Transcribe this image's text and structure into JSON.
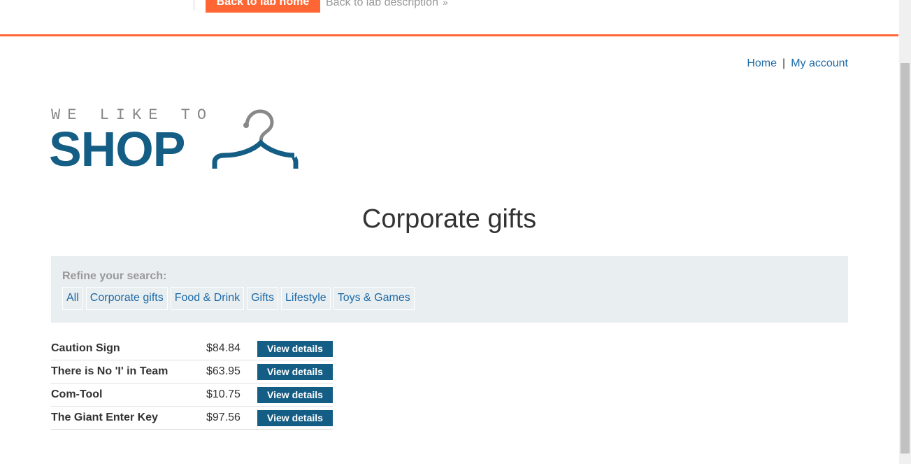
{
  "banner": {
    "back_home": "Back to lab home",
    "back_desc": "Back to lab description",
    "back_desc_chevron": "»",
    "accent": "#ff6633"
  },
  "nav": {
    "home": "Home",
    "separator": "|",
    "account": "My account"
  },
  "logo": {
    "tagline": "WE LIKE TO",
    "word": "SHOP",
    "icon": "hanger-icon",
    "brand_color": "#145d85"
  },
  "page": {
    "title": "Corporate gifts"
  },
  "filters": {
    "label": "Refine your search:",
    "categories": [
      "All",
      "Corporate gifts",
      "Food & Drink",
      "Gifts",
      "Lifestyle",
      "Toys & Games"
    ]
  },
  "products": [
    {
      "name": "Caution Sign",
      "price": "$84.84",
      "action": "View details"
    },
    {
      "name": "There is No 'I' in Team",
      "price": "$63.95",
      "action": "View details"
    },
    {
      "name": "Com-Tool",
      "price": "$10.75",
      "action": "View details"
    },
    {
      "name": "The Giant Enter Key",
      "price": "$97.56",
      "action": "View details"
    }
  ]
}
